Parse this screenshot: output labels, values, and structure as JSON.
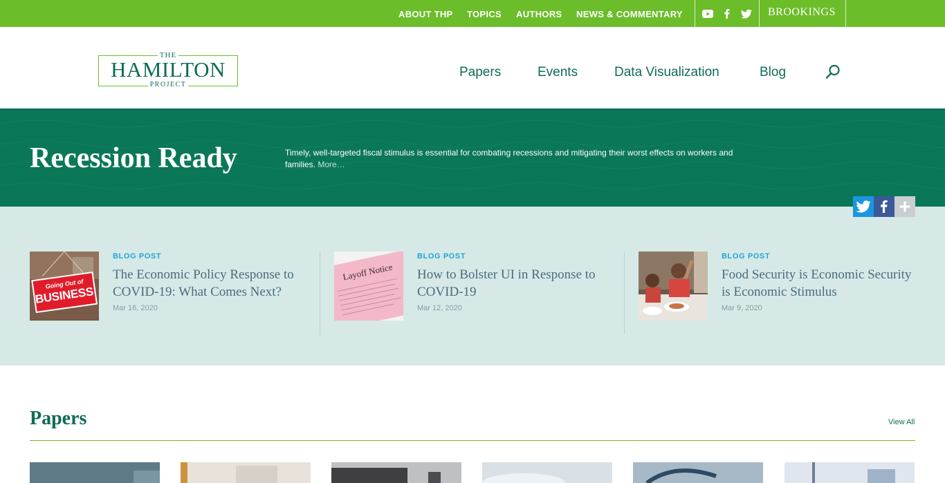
{
  "topbar": {
    "links": [
      "ABOUT THP",
      "TOPICS",
      "AUTHORS",
      "NEWS & COMMENTARY"
    ],
    "social_icons": [
      "youtube-icon",
      "facebook-icon",
      "twitter-icon"
    ],
    "brookings": "BROOKINGS",
    "bg_color": "#6cbd2a"
  },
  "logo": {
    "the": "THE",
    "main": "HAMILTON",
    "project": "PROJECT"
  },
  "nav": {
    "items": [
      "Papers",
      "Events",
      "Data Visualization",
      "Blog"
    ],
    "search_icon": "search-icon"
  },
  "hero": {
    "title": "Recession Ready",
    "description": "Timely, well-targeted fiscal stimulus is essential for combating recessions and mitigating their worst effects on workers and families.",
    "more": "More…",
    "bg_color": "#0b7759"
  },
  "share": {
    "icons": [
      "twitter-icon",
      "facebook-icon",
      "plus-icon"
    ]
  },
  "blog": {
    "cards": [
      {
        "kicker": "BLOG POST",
        "title": "The Economic Policy Response to COVID-19: What Comes Next?",
        "date": "Mar 16, 2020",
        "sign_line1": "Going Out of",
        "sign_line2": "BUSINESS"
      },
      {
        "kicker": "BLOG POST",
        "title": "How to Bolster UI in Response to COVID-19",
        "date": "Mar 12, 2020",
        "paper_text": "Layoff Notice"
      },
      {
        "kicker": "BLOG POST",
        "title": "Food Security is Economic Security is Economic Stimulus",
        "date": "Mar 9, 2020"
      }
    ]
  },
  "papers": {
    "heading": "Papers",
    "view_all": "View All"
  }
}
